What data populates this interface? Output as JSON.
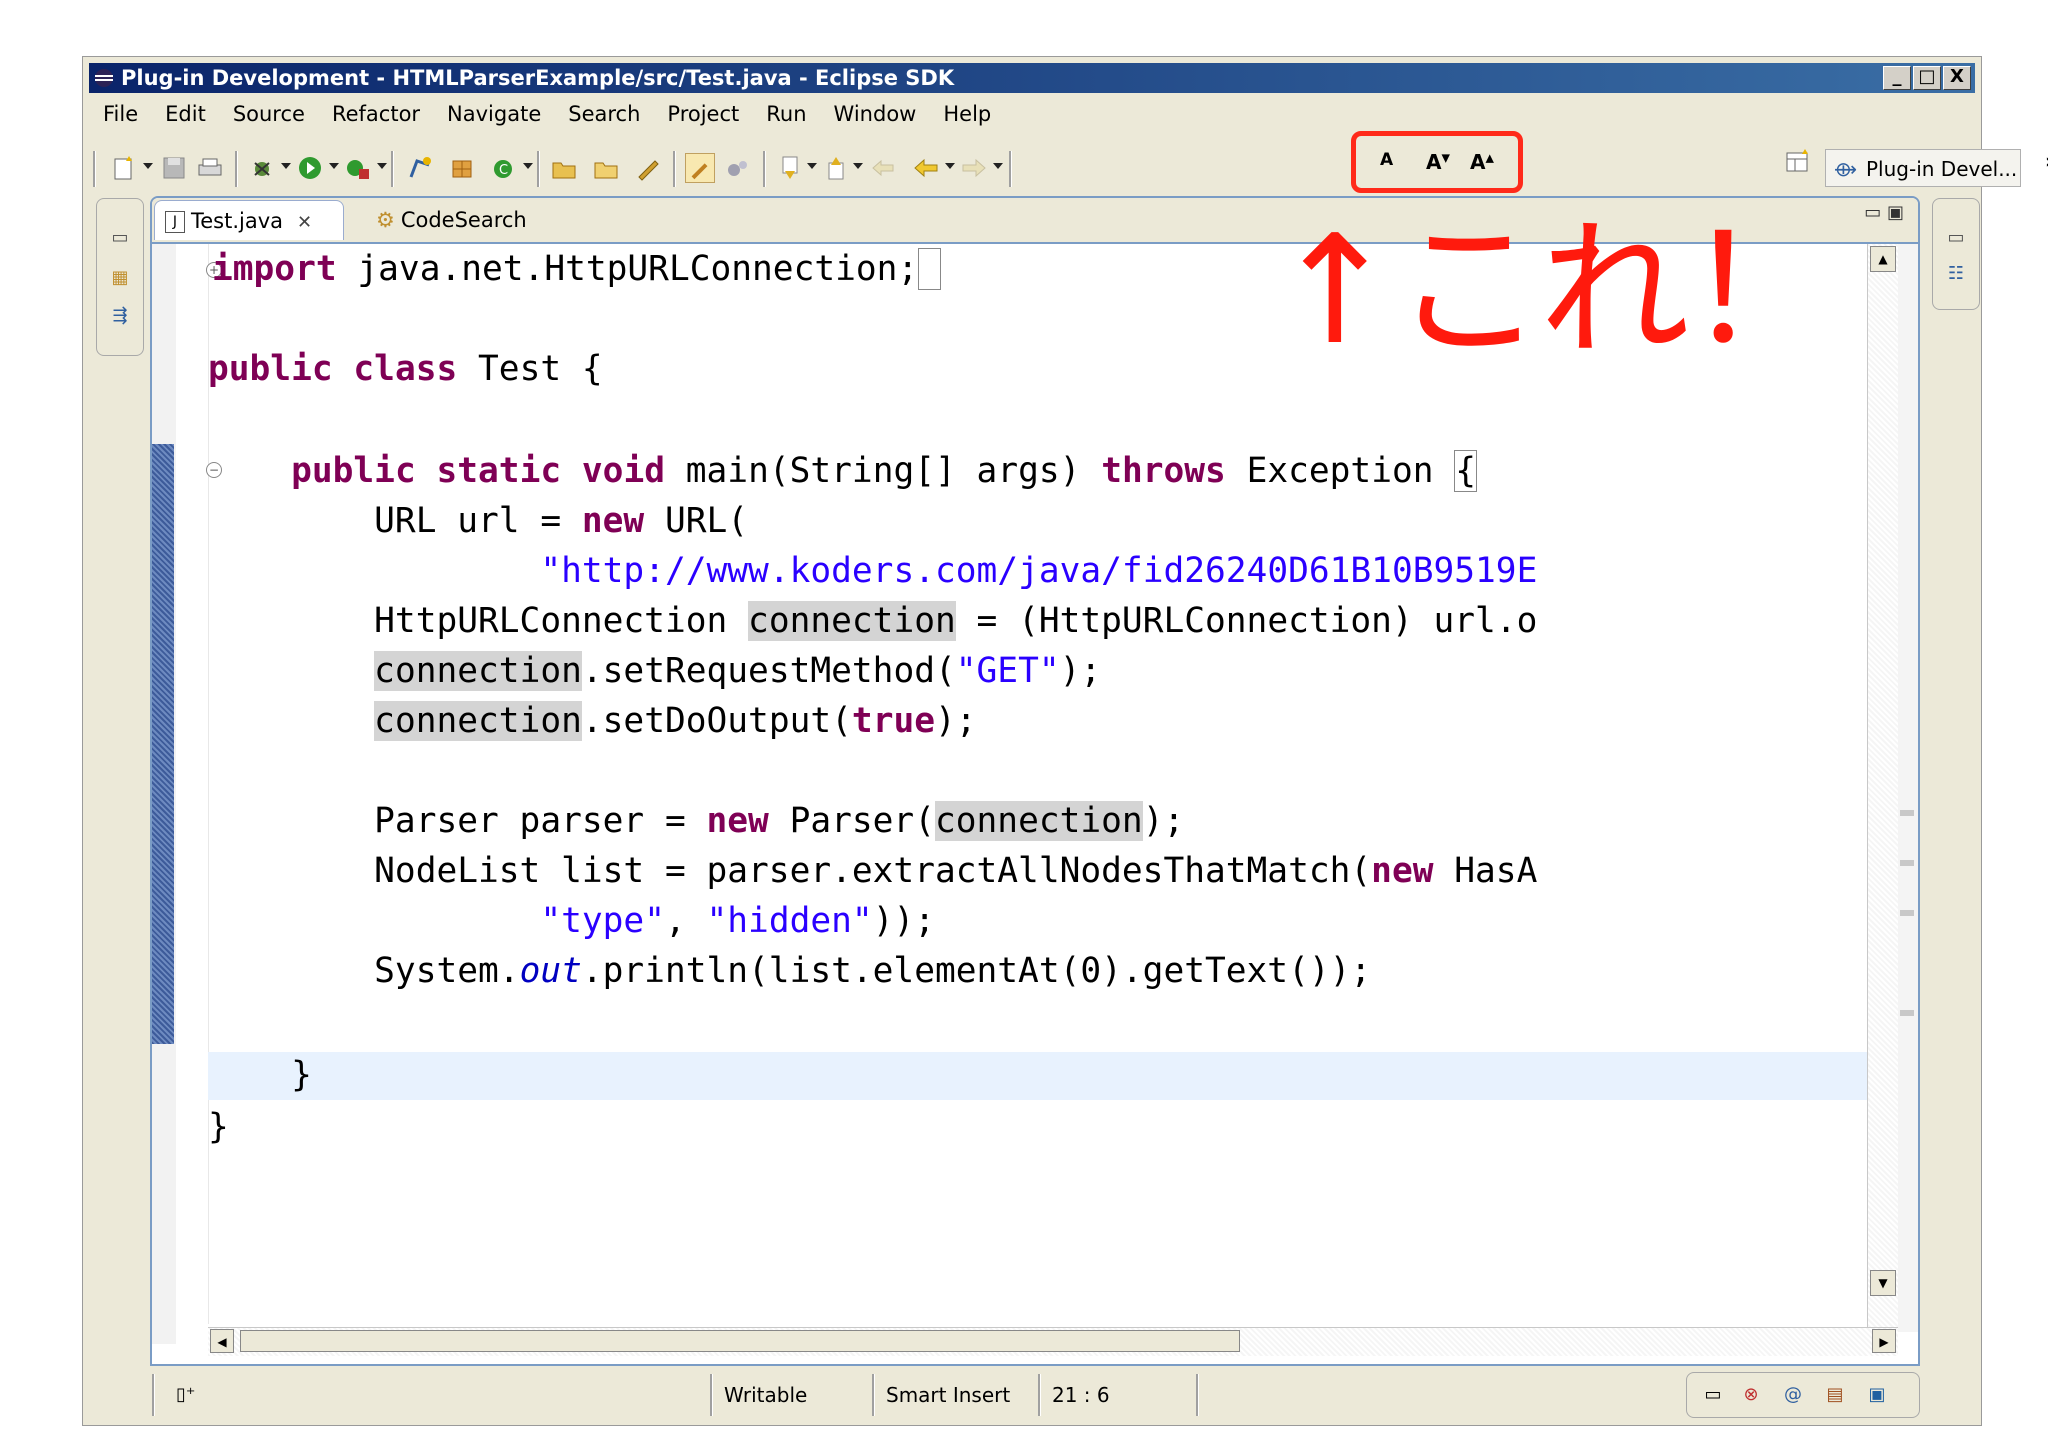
{
  "window": {
    "title": "Plug-in Development - HTMLParserExample/src/Test.java - Eclipse SDK",
    "controls": [
      "_",
      "□",
      "X"
    ]
  },
  "menu": [
    {
      "label": "File"
    },
    {
      "label": "Edit"
    },
    {
      "label": "Source"
    },
    {
      "label": "Refactor"
    },
    {
      "label": "Navigate"
    },
    {
      "label": "Search"
    },
    {
      "label": "Project"
    },
    {
      "label": "Run"
    },
    {
      "label": "Window"
    },
    {
      "label": "Help"
    }
  ],
  "font_buttons": [
    "A",
    "A",
    "A"
  ],
  "perspective": {
    "label": "Plug-in Devel..."
  },
  "chevron": "»",
  "tabs": [
    {
      "label": "Test.java",
      "icon": "java-file-icon",
      "close": "✕"
    },
    {
      "label": "CodeSearch",
      "icon": "code-search-icon"
    }
  ],
  "code_lines": [
    "import java.net.HttpURLConnection;",
    "public class Test {",
    "public static void main(String[] args) throws Exception {",
    "URL url = new URL(",
    "\"http://www.koders.com/java/fid26240D61B10B9519E",
    "HttpURLConnection connection = (HttpURLConnection) url.o",
    "connection.setRequestMethod(\"GET\");",
    "connection.setDoOutput(true);",
    "Parser parser = new Parser(connection);",
    "NodeList list = parser.extractAllNodesThatMatch(new HasA",
    "\"type\", \"hidden\"));",
    "System.out.println(list.elementAt(0).getText());",
    "}",
    "}"
  ],
  "status": {
    "writable": "Writable",
    "insert_mode": "Smart Insert",
    "position": "21 : 6"
  },
  "annotation": "↑これ！",
  "colors": {
    "annotation_red": "#ff1a0d",
    "keyword": "#7f0055",
    "string": "#2a00ff"
  }
}
